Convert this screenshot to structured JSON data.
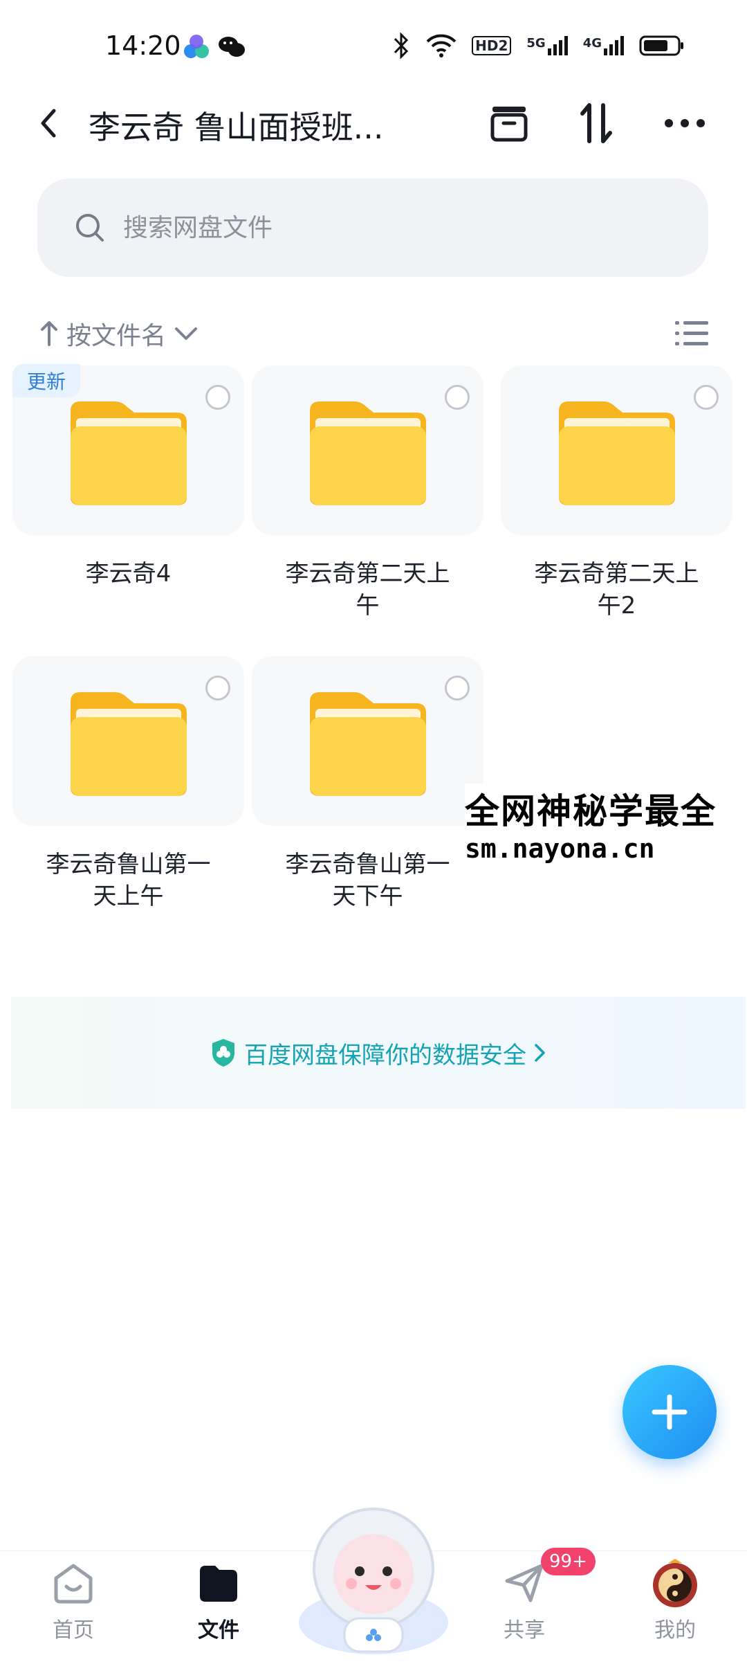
{
  "status_bar": {
    "time": "14:20",
    "network_labels": [
      "HD2",
      "5G",
      "4G"
    ]
  },
  "header": {
    "title": "李云奇 鲁山面授班..."
  },
  "search": {
    "placeholder": "搜索网盘文件"
  },
  "sort": {
    "label": "按文件名"
  },
  "folders": [
    {
      "name_line1": "李云奇4",
      "name_line2": "",
      "badge": "更新"
    },
    {
      "name_line1": "李云奇第二天上",
      "name_line2": "午",
      "badge": ""
    },
    {
      "name_line1": "李云奇第二天上",
      "name_line2": "午2",
      "badge": ""
    },
    {
      "name_line1": "李云奇鲁山第一",
      "name_line2": "天上午",
      "badge": ""
    },
    {
      "name_line1": "李云奇鲁山第一",
      "name_line2": "天下午",
      "badge": ""
    }
  ],
  "overlay": {
    "line1": "全网神秘学最全",
    "line2": "sm.nayona.cn"
  },
  "banner": {
    "text": "百度网盘保障你的数据安全"
  },
  "bottom_nav": [
    {
      "label": "首页"
    },
    {
      "label": "文件"
    },
    {
      "label": ""
    },
    {
      "label": "共享",
      "badge": "99+"
    },
    {
      "label": "我的"
    }
  ],
  "colors": {
    "accent": "#1e8df2",
    "folder": "#fcd34d",
    "banner_text": "#15a3b3",
    "badge": "#f2416b"
  }
}
